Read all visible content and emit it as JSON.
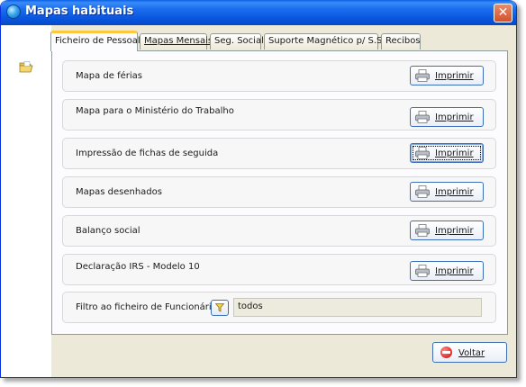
{
  "window": {
    "title": "Mapas habituais",
    "close_label": "✕"
  },
  "tabs": [
    {
      "label": "Ficheiro de Pessoal",
      "active": true
    },
    {
      "label": "Mapas Mensais",
      "active": false
    },
    {
      "label": "Seg. Social",
      "active": false
    },
    {
      "label": "Suporte Magnético p/ S.S.",
      "active": false
    },
    {
      "label": "Recibos",
      "active": false
    }
  ],
  "rows": [
    {
      "label": "Mapa de férias",
      "button": "Imprimir"
    },
    {
      "label": "Mapa para o Ministério do Trabalho",
      "button": "Imprimir"
    },
    {
      "label": "Impressão de fichas de seguida",
      "button": "Imprimir"
    },
    {
      "label": "Mapas desenhados",
      "button": "Imprimir"
    },
    {
      "label": "Balanço social",
      "button": "Imprimir"
    },
    {
      "label": "Declaração IRS - Modelo 10",
      "button": "Imprimir"
    }
  ],
  "filter": {
    "label": "Filtro ao ficheiro de Funcionários",
    "value": "todos"
  },
  "footer": {
    "back_label": "Voltar"
  },
  "icons": {
    "title": "app-globe-icon",
    "sidebar": "open-folder-icon",
    "print": "printer-icon",
    "filter": "funnel-icon",
    "back": "stop-icon"
  },
  "colors": {
    "titlebar": "#0a58e0",
    "close": "#d4512b",
    "active_tab_accent": "#ffc83c",
    "button_border": "#3c6fb8"
  }
}
